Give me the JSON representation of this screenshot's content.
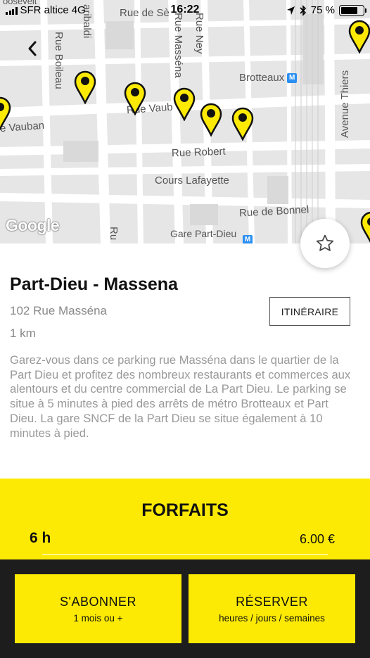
{
  "status_bar": {
    "carrier": "SFR altice",
    "network": "4G",
    "time": "16:22",
    "battery": "75 %",
    "battery_level": 0.75
  },
  "map": {
    "streets": {
      "rue_de_sevigne": "Rue de Sè",
      "garibaldi": "aribaldi",
      "rue_boileau": "Rue Boileau",
      "rue_massena": "Rue Masséna",
      "rue_ney": "Rue Ney",
      "brotteaux": "Brotteaux",
      "avenue_thiers": "Avenue Thiers",
      "rue_vauban_left": "e Vauban",
      "rue_vauban_mid": "Rue Vaub",
      "rue_robert": "Rue Robert",
      "cours_lafayette": "Cours Lafayette",
      "rue_de_bonnel": "Rue de Bonnel",
      "gare_part_dieu": "Gare Part-Dieu",
      "roosevelt": "oosevelt",
      "rue_fragment": "Ru"
    },
    "metro_badge": "M",
    "google_logo": "Google",
    "pin_color": "#fcea04"
  },
  "parking": {
    "name": "Part-Dieu - Massena",
    "address": "102 Rue Masséna",
    "distance": "1 km",
    "itinerary_label": "ITINÉRAIRE",
    "description": "Garez-vous dans ce parking rue Masséna dans le quartier de la Part Dieu et profitez des nombreux restaurants et commerces aux alentours et du centre commercial de La Part Dieu. Le parking se situe à 5 minutes à pied des arrêts de métro Brotteaux et Part Dieu. La gare SNCF de la Part Dieu se situe également à 10 minutes à pied."
  },
  "forfaits": {
    "title": "FORFAITS",
    "items": [
      {
        "duration": "6 h",
        "price": "6.00 €"
      }
    ]
  },
  "actions": {
    "subscribe_label": "S'ABONNER",
    "subscribe_sub": "1 mois ou +",
    "reserve_label": "RÉSERVER",
    "reserve_sub": "heures / jours / semaines"
  },
  "colors": {
    "accent": "#fcea04",
    "bottom_bar": "#1d1d1d",
    "metro": "#2b8ff0"
  }
}
